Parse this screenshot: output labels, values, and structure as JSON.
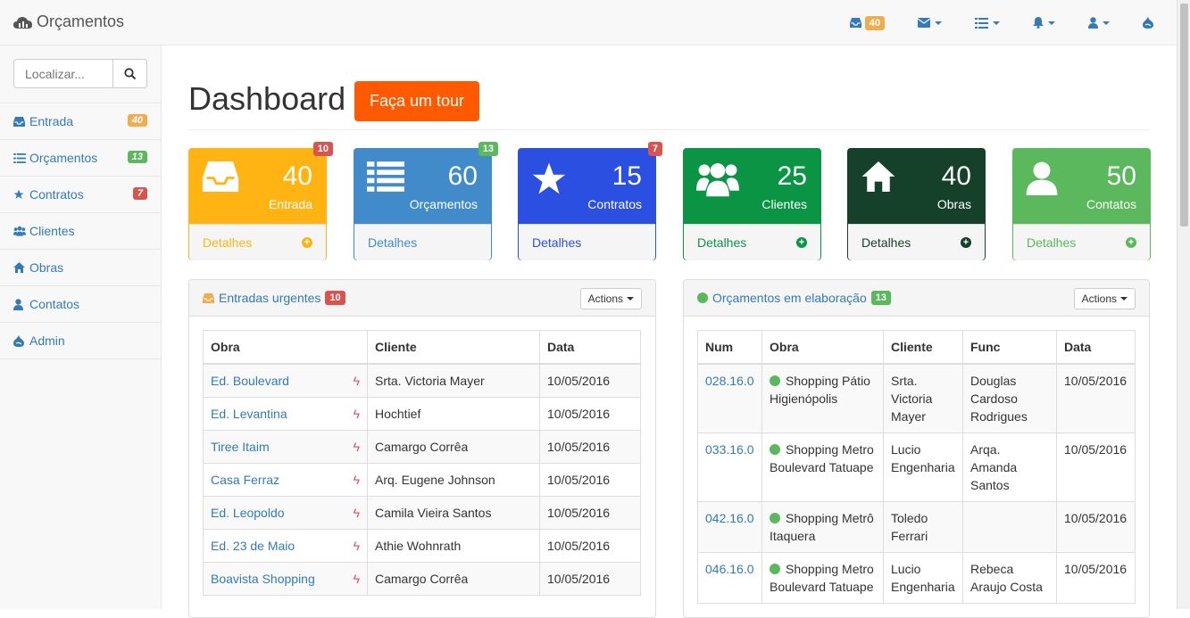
{
  "brand": {
    "title": "Orçamentos"
  },
  "topnav": {
    "inbox_badge": "40"
  },
  "sidebar": {
    "search_placeholder": "Localizar...",
    "items": [
      {
        "label": "Entrada",
        "badge": "40",
        "badge_color": "#f0ad4e",
        "icon": "inbox-icon"
      },
      {
        "label": "Orçamentos",
        "badge": "13",
        "badge_color": "#5cb85c",
        "icon": "list-icon"
      },
      {
        "label": "Contratos",
        "badge": "7",
        "badge_color": "#d9534f",
        "icon": "star-icon"
      },
      {
        "label": "Clientes",
        "icon": "users-icon"
      },
      {
        "label": "Obras",
        "icon": "home-icon"
      },
      {
        "label": "Contatos",
        "icon": "user-icon"
      },
      {
        "label": "Admin",
        "icon": "drupal-icon"
      }
    ]
  },
  "page": {
    "title": "Dashboard",
    "tour_label": "Faça um tour"
  },
  "cards": [
    {
      "value": "40",
      "label": "Entrada",
      "badge": "10",
      "details": "Detalhes",
      "color": "#ffb414",
      "badge_color": "#d9534f",
      "icon": "inbox-icon"
    },
    {
      "value": "60",
      "label": "Orçamentos",
      "badge": "13",
      "details": "Detalhes",
      "color": "#428bca",
      "badge_color": "#5cb85c",
      "icon": "list-icon"
    },
    {
      "value": "15",
      "label": "Contratos",
      "badge": "7",
      "details": "Detalhes",
      "color": "#2b4fe0",
      "badge_color": "#d9534f",
      "icon": "star-icon"
    },
    {
      "value": "25",
      "label": "Clientes",
      "details": "Detalhes",
      "color": "#0b9444",
      "icon": "users-icon"
    },
    {
      "value": "40",
      "label": "Obras",
      "details": "Detalhes",
      "color": "#15402a",
      "icon": "home-icon"
    },
    {
      "value": "50",
      "label": "Contatos",
      "details": "Detalhes",
      "color": "#5cb85c",
      "icon": "user-icon"
    }
  ],
  "panel_left": {
    "title": "Entradas urgentes",
    "badge": "10",
    "actions": "Actions",
    "columns": [
      "Obra",
      "Cliente",
      "Data"
    ],
    "rows": [
      {
        "obra": "Ed. Boulevard",
        "cliente": "Srta. Victoria Mayer",
        "data": "10/05/2016"
      },
      {
        "obra": "Ed. Levantina",
        "cliente": "Hochtief",
        "data": "10/05/2016"
      },
      {
        "obra": "Tiree Itaim",
        "cliente": "Camargo Corrêa",
        "data": "10/05/2016"
      },
      {
        "obra": "Casa Ferraz",
        "cliente": "Arq. Eugene Johnson",
        "data": "10/05/2016"
      },
      {
        "obra": "Ed. Leopoldo",
        "cliente": "Camila Vieira Santos",
        "data": "10/05/2016"
      },
      {
        "obra": "Ed. 23 de Maio",
        "cliente": "Athie Wohnrath",
        "data": "10/05/2016"
      },
      {
        "obra": "Boavista Shopping",
        "cliente": "Camargo Corrêa",
        "data": "10/05/2016"
      }
    ]
  },
  "panel_right": {
    "title": "Orçamentos em elaboração",
    "badge": "13",
    "actions": "Actions",
    "columns": [
      "Num",
      "Obra",
      "Cliente",
      "Func",
      "Data"
    ],
    "rows": [
      {
        "num": "028.16.0",
        "obra": "Shopping Pátio Higienópolis",
        "cliente": "Srta. Victoria Mayer",
        "func": "Douglas Cardoso Rodrigues",
        "data": "10/05/2016"
      },
      {
        "num": "033.16.0",
        "obra": "Shopping Metro Boulevard Tatuape",
        "cliente": "Lucio Engenharia",
        "func": "Arqa. Amanda Santos",
        "data": "10/05/2016"
      },
      {
        "num": "042.16.0",
        "obra": "Shopping Metrô Itaquera",
        "cliente": "Toledo Ferrari",
        "func": "",
        "data": "10/05/2016"
      },
      {
        "num": "046.16.0",
        "obra": "Shopping Metro Boulevard Tatuape",
        "cliente": "Lucio Engenharia",
        "func": "Rebeca Araujo Costa",
        "data": "10/05/2016"
      }
    ]
  }
}
